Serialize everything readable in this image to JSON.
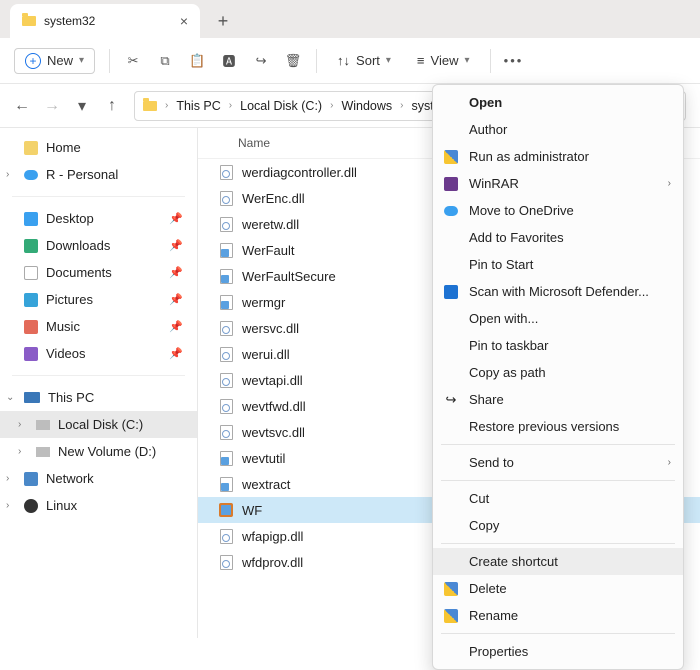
{
  "tab": {
    "title": "system32"
  },
  "toolbar": {
    "new_label": "New",
    "sort_label": "Sort",
    "view_label": "View"
  },
  "breadcrumb": [
    "This PC",
    "Local Disk (C:)",
    "Windows",
    "system32"
  ],
  "sidebar": {
    "home": "Home",
    "personal": "R - Personal",
    "quick": [
      "Desktop",
      "Downloads",
      "Documents",
      "Pictures",
      "Music",
      "Videos"
    ],
    "thispc": "This PC",
    "drives": [
      "Local Disk (C:)",
      "New Volume (D:)"
    ],
    "network": "Network",
    "linux": "Linux"
  },
  "columns": {
    "name": "Name"
  },
  "files": [
    {
      "name": "werdiagcontroller.dll",
      "type": "dll"
    },
    {
      "name": "WerEnc.dll",
      "type": "dll"
    },
    {
      "name": "weretw.dll",
      "type": "dll"
    },
    {
      "name": "WerFault",
      "type": "exe"
    },
    {
      "name": "WerFaultSecure",
      "type": "exe"
    },
    {
      "name": "wermgr",
      "type": "exe"
    },
    {
      "name": "wersvc.dll",
      "type": "dll"
    },
    {
      "name": "werui.dll",
      "type": "dll"
    },
    {
      "name": "wevtapi.dll",
      "type": "dll"
    },
    {
      "name": "wevtfwd.dll",
      "type": "dll"
    },
    {
      "name": "wevtsvc.dll",
      "type": "dll"
    },
    {
      "name": "wevtutil",
      "type": "exe"
    },
    {
      "name": "wextract",
      "type": "exe"
    },
    {
      "name": "WF",
      "type": "wf",
      "selected": true
    },
    {
      "name": "wfapigp.dll",
      "type": "dll"
    },
    {
      "name": "wfdprov.dll",
      "type": "dll"
    }
  ],
  "context_menu": {
    "open": "Open",
    "author": "Author",
    "run_admin": "Run as administrator",
    "winrar": "WinRAR",
    "onedrive": "Move to OneDrive",
    "favorites": "Add to Favorites",
    "pin_start": "Pin to Start",
    "defender": "Scan with Microsoft Defender...",
    "open_with": "Open with...",
    "pin_taskbar": "Pin to taskbar",
    "copy_path": "Copy as path",
    "share": "Share",
    "restore": "Restore previous versions",
    "send_to": "Send to",
    "cut": "Cut",
    "copy": "Copy",
    "create_shortcut": "Create shortcut",
    "delete": "Delete",
    "rename": "Rename",
    "properties": "Properties"
  }
}
